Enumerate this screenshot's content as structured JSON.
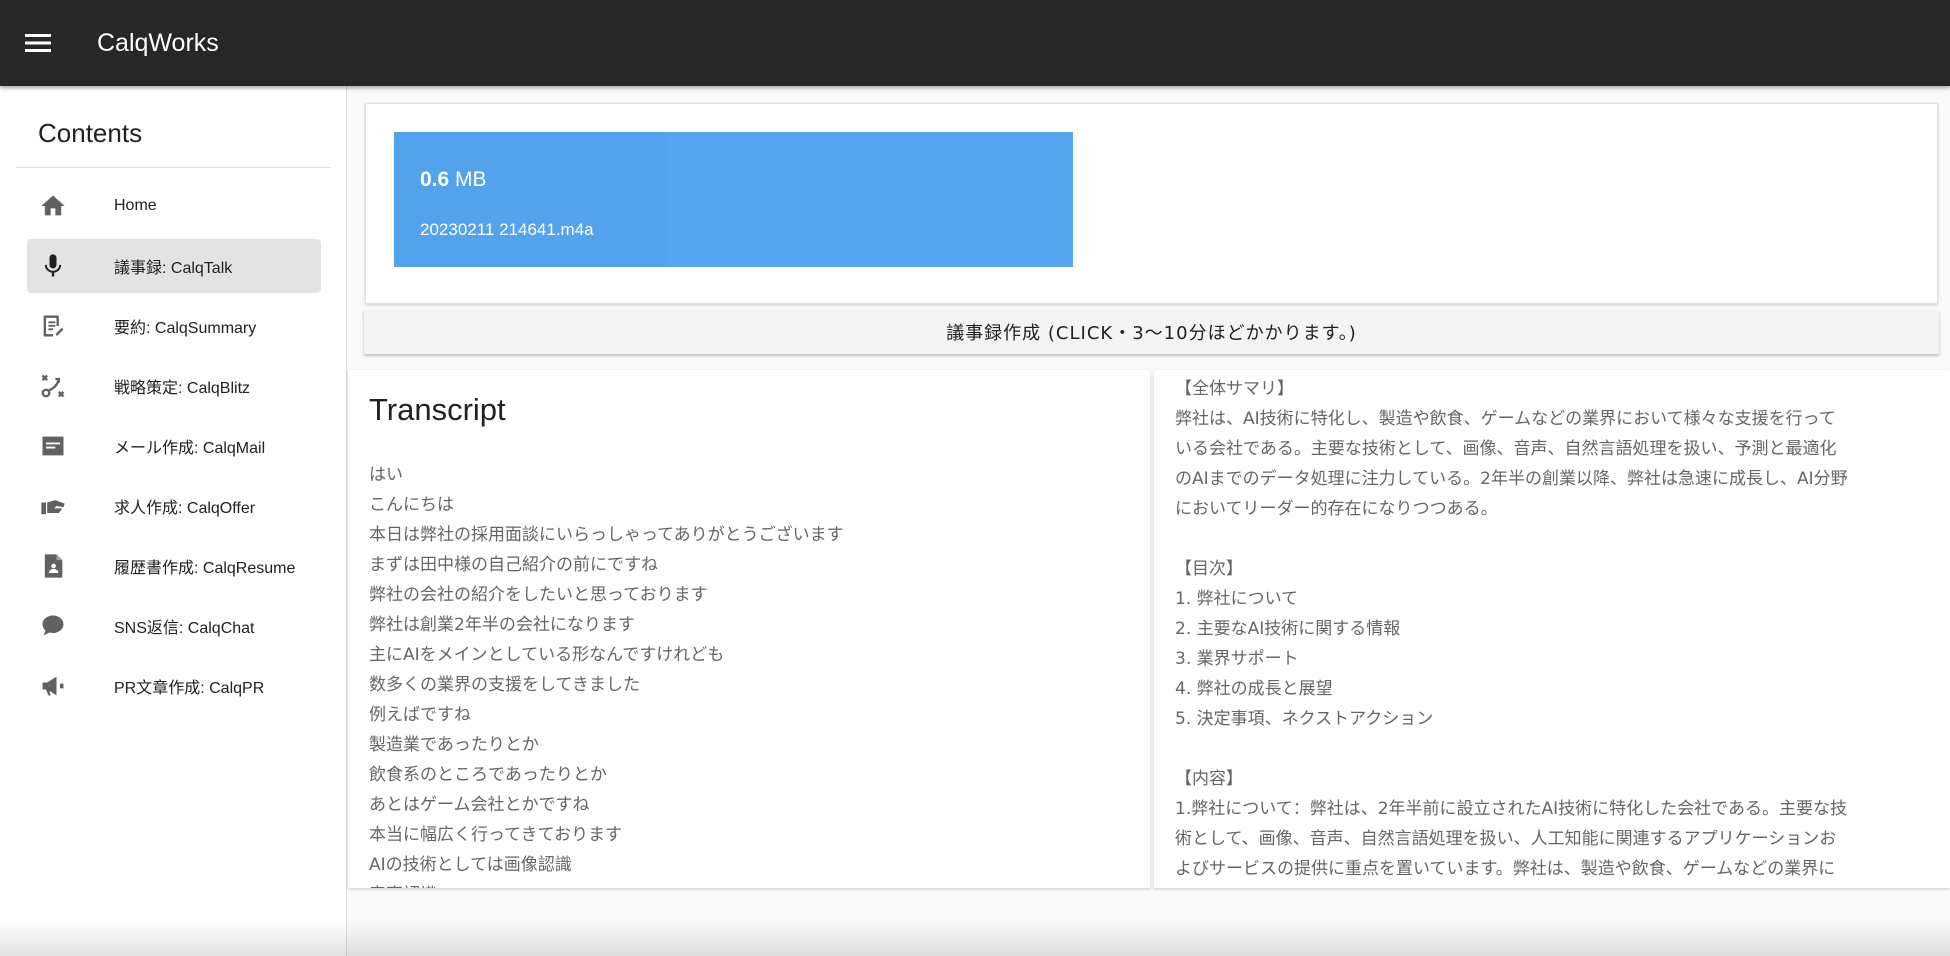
{
  "app": {
    "title": "CalqWorks"
  },
  "sidebar": {
    "header": "Contents",
    "items": [
      {
        "label": "Home",
        "icon": "home-icon"
      },
      {
        "label": "議事録: CalqTalk",
        "icon": "mic-icon",
        "active": true
      },
      {
        "label": "要約: CalqSummary",
        "icon": "edit-note-icon"
      },
      {
        "label": "戦略策定: CalqBlitz",
        "icon": "strategy-icon"
      },
      {
        "label": "メール作成: CalqMail",
        "icon": "mail-card-icon"
      },
      {
        "label": "求人作成: CalqOffer",
        "icon": "offer-icon"
      },
      {
        "label": "履歴書作成: CalqResume",
        "icon": "resume-icon"
      },
      {
        "label": "SNS返信: CalqChat",
        "icon": "chat-icon"
      },
      {
        "label": "PR文章作成: CalqPR",
        "icon": "megaphone-icon"
      }
    ]
  },
  "upload": {
    "size_value": "0.6",
    "size_unit": "MB",
    "file_name": "20230211 214641.m4a",
    "progress": 0.4
  },
  "action": {
    "label": "議事録作成 (CLICK・3〜10分ほどかかります。)"
  },
  "transcript": {
    "title": "Transcript",
    "lines": [
      "はい",
      "こんにちは",
      "本日は弊社の採用面談にいらっしゃってありがとうございます",
      "まずは田中様の自己紹介の前にですね",
      "弊社の会社の紹介をしたいと思っております",
      "弊社は創業2年半の会社になります",
      "主にAIをメインとしている形なんですけれども",
      "数多くの業界の支援をしてきました",
      "例えばですね",
      "製造業であったりとか",
      "飲食系のところであったりとか",
      "あとはゲーム会社とかですね",
      "本当に幅広く行ってきております",
      "AIの技術としては画像認識",
      "音声認識"
    ]
  },
  "summary": {
    "lines": [
      "【全体サマリ】",
      "弊社は、AI技術に特化し、製造や飲食、ゲームなどの業界において様々な支援を行って",
      "いる会社である。主要な技術として、画像、音声、自然言語処理を扱い、予測と最適化",
      "のAIまでのデータ処理に注力している。2年半の創業以降、弊社は急速に成長し、AI分野",
      "においてリーダー的存在になりつつある。",
      "",
      "【目次】",
      "1. 弊社について",
      "2. 主要なAI技術に関する情報",
      "3. 業界サポート",
      "4. 弊社の成長と展望",
      "5. 決定事項、ネクストアクション",
      "",
      "【内容】",
      "1.弊社について：弊社は、2年半前に設立されたAI技術に特化した会社である。主要な技",
      "術として、画像、音声、自然言語処理を扱い、人工知能に関連するアプリケーションお",
      "よびサービスの提供に重点を置いています。弊社は、製造や飲食、ゲームなどの業界に"
    ]
  }
}
